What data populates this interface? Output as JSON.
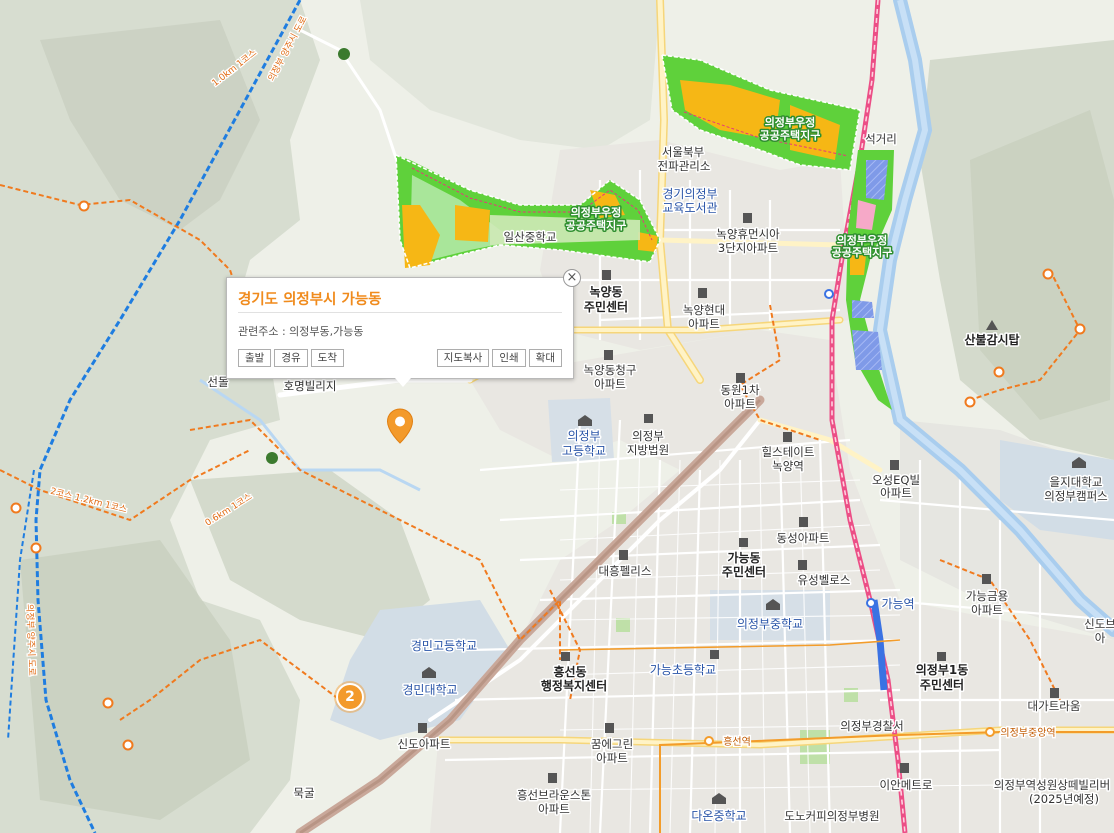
{
  "popup": {
    "title": "경기도 의정부시 가능동",
    "address_label": "관련주소 : 의정부동,가능동",
    "buttons_left": [
      "출발",
      "경유",
      "도착"
    ],
    "buttons_right": [
      "지도복사",
      "인쇄",
      "확대"
    ],
    "close_symbol": "×"
  },
  "cluster": {
    "count": "2"
  },
  "labels": {
    "seoul_power": [
      "서울북부",
      "전파관리소"
    ],
    "gyeonggi_library": [
      "경기의정부",
      "교육도서관"
    ],
    "noksang_sia": [
      "녹양휴먼시아",
      "3단지아파트"
    ],
    "nokyang_center": [
      "녹양동",
      "주민센터"
    ],
    "nokyang_hyundai": [
      "녹양현대",
      "아파트"
    ],
    "nokyang_cheonggu": [
      "녹양동청구",
      "아파트"
    ],
    "dongwon": [
      "동원1차",
      "아파트"
    ],
    "hillstate": [
      "힐스테이트",
      "녹양역"
    ],
    "highschool": [
      "의정부",
      "고등학교"
    ],
    "court": [
      "의정부",
      "지방법원"
    ],
    "daeheung": "대흥펠리스",
    "ganeung_center": [
      "가능동",
      "주민센터"
    ],
    "dongseong": "동성아파트",
    "yuseong": "유성벨로스",
    "middle_school": "의정부중학교",
    "ganeung_station": "가능역",
    "ganeung_elementary": "가능초등학교",
    "heungseon_center": [
      "흥선동",
      "행정복지센터"
    ],
    "gyeongmin_high": "경민고등학교",
    "gyeongmin_univ": "경민대학교",
    "sindo": "신도아파트",
    "ggumegrin": [
      "꿈에그린",
      "아파트"
    ],
    "mukgul": "묵굴",
    "heungseon_brown": [
      "흥선브라운스톤",
      "아파트"
    ],
    "dao_middle": "다온중학교",
    "hospital": "도노커피의정부병원",
    "police": "의정부경찰서",
    "heungseon_station": "흥선역",
    "ijeongbu_central": "의정부중앙역",
    "ian_metro": "이안메트로",
    "eu_euljiu": [
      "을지대학교",
      "의정부캠퍼스"
    ],
    "osung": [
      "오성EQ빌",
      "아파트"
    ],
    "ganeung_gumyoung": [
      "가능금용",
      "아파트"
    ],
    "uijeongbu1dong": [
      "의정부1동",
      "주민센터"
    ],
    "daega": "대가트라움",
    "sindo_right": [
      "신도브",
      "아"
    ],
    "sanbul": "산불감시탑",
    "seokgeori": "석거리",
    "seondol": "선돌",
    "hyosung_villa": "호명빌리지",
    "junior_school": "의정부고등학교",
    "dist_north": [
      "의정부우정",
      "공공주택지구"
    ],
    "dist_west": [
      "의정부우정",
      "공공주택지구"
    ],
    "dist_east": [
      "의정부우정",
      "공공주택지구"
    ],
    "jinsan": "일산중학교",
    "station_right": [
      "의정부역성원상떼빌리버",
      "(2025년예정)"
    ],
    "trail_1": "1.0km 1코스",
    "trail_2": "2코스 1.2km 1코스",
    "trail_3": "0.6km 1코스",
    "vert_road": "의정부 양주시 도로",
    "vert_road2": "의정부 양주시 도로"
  },
  "colors": {
    "accent": "#f08b1d",
    "district_green": "#5fd13b",
    "district_yellow": "#f6b715",
    "district_blue": "#8da2f0",
    "district_pink": "#f6a9c8",
    "railway": "#e7387a",
    "bus_route": "#1f7de0",
    "trail": "#f07a1e",
    "water": "#b9d7f2"
  },
  "icons": {
    "pin": "map-pin-icon",
    "cluster": "cluster-marker",
    "close": "close-icon",
    "apartment": "apartment-icon",
    "school": "school-icon",
    "government": "government-icon"
  }
}
